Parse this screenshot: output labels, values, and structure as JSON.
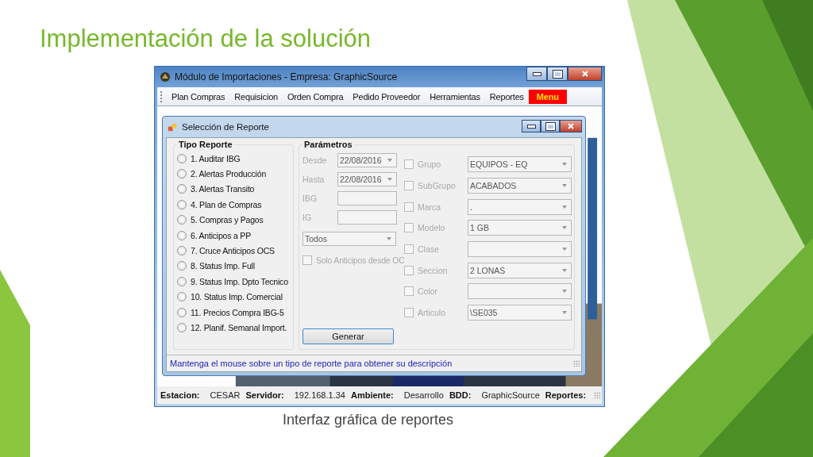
{
  "slide": {
    "title": "Implementación de la solución",
    "caption": "Interfaz gráfica de reportes"
  },
  "window": {
    "title": "Módulo de Importaciones - Empresa: GraphicSource",
    "menu": [
      {
        "label": "Plan Compras",
        "highlighted": false
      },
      {
        "label": "Requisicion",
        "highlighted": false
      },
      {
        "label": "Orden Compra",
        "highlighted": false
      },
      {
        "label": "Pedido Proveedor",
        "highlighted": false
      },
      {
        "label": "Herramientas",
        "highlighted": false
      },
      {
        "label": "Reportes",
        "highlighted": false
      },
      {
        "label": "Menu",
        "highlighted": true
      }
    ],
    "dialog": {
      "title": "Selección de Reporte",
      "tipo_reporte": {
        "title": "Tipo Reporte",
        "options": [
          {
            "label": "1. Auditar IBG",
            "selected": false
          },
          {
            "label": "2. Alertas Producción",
            "selected": false
          },
          {
            "label": "3. Alertas Transito",
            "selected": false
          },
          {
            "label": "4. Plan de Compras",
            "selected": false
          },
          {
            "label": "5. Compras y Pagos",
            "selected": false
          },
          {
            "label": "6. Anticipos a PP",
            "selected": false
          },
          {
            "label": "7. Cruce Anticipos OCS",
            "selected": false
          },
          {
            "label": "8. Status Imp. Full",
            "selected": false
          },
          {
            "label": "9. Status Imp. Dpto Tecnico",
            "selected": false
          },
          {
            "label": "10. Status Imp. Comercial",
            "selected": false
          },
          {
            "label": "11. Precios Compra IBG-5",
            "selected": false
          },
          {
            "label": "12. Planif. Semanal Import.",
            "selected": false
          }
        ]
      },
      "parametros": {
        "title": "Parámetros",
        "fields": [
          {
            "kind": "date",
            "label": "Desde",
            "value": "22/08/2016"
          },
          {
            "kind": "date",
            "label": "Hasta",
            "value": "22/08/2016"
          },
          {
            "kind": "text",
            "label": "IBG"
          },
          {
            "kind": "text",
            "label": "IG"
          }
        ],
        "filter": {
          "value": "Todos"
        },
        "checkbox": {
          "label": "Solo Anticipos desde OC",
          "checked": false
        },
        "button": "Generar",
        "filters": [
          {
            "label": "Grupo",
            "checked": false,
            "value": "EQUIPOS - EQ"
          },
          {
            "label": "SubGrupo",
            "checked": false,
            "value": "ACABADOS"
          },
          {
            "label": "Marca",
            "checked": false,
            "value": "."
          },
          {
            "label": "Modelo",
            "checked": false,
            "value": "1 GB"
          },
          {
            "label": "Clase",
            "checked": false
          },
          {
            "label": "Seccion",
            "checked": false,
            "value": "2 LONAS"
          },
          {
            "label": "Color",
            "checked": false
          },
          {
            "label": "Articulo",
            "checked": false,
            "value": "\\SE035"
          }
        ]
      },
      "hint": "Mantenga el mouse sobre un tipo de reporte para obtener su descripción"
    },
    "status_bar": [
      {
        "label": "Estacion:",
        "value": "CESAR"
      },
      {
        "label": "Servidor:",
        "value": "192.168.1.34"
      },
      {
        "label": "Ambiente:",
        "value": "Desarrollo"
      },
      {
        "label": "BDD:",
        "value": "GraphicSource"
      },
      {
        "label": "Reportes:"
      }
    ]
  }
}
